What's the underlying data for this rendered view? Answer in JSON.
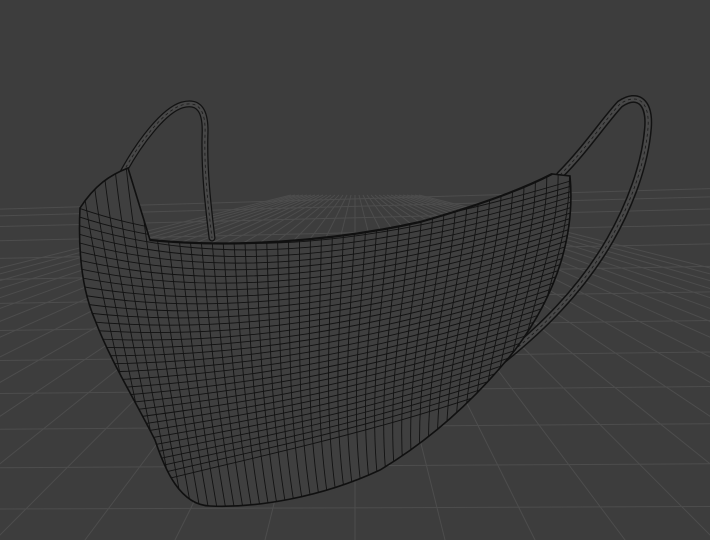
{
  "viewport": {
    "mode": "wireframe",
    "subject": "face-mask-mesh",
    "colors": {
      "background": "#3d3d3d",
      "floor_grid": "#4d4d4d",
      "mesh_wire": "#121212",
      "mesh_fill": "#3f3f3f"
    }
  }
}
